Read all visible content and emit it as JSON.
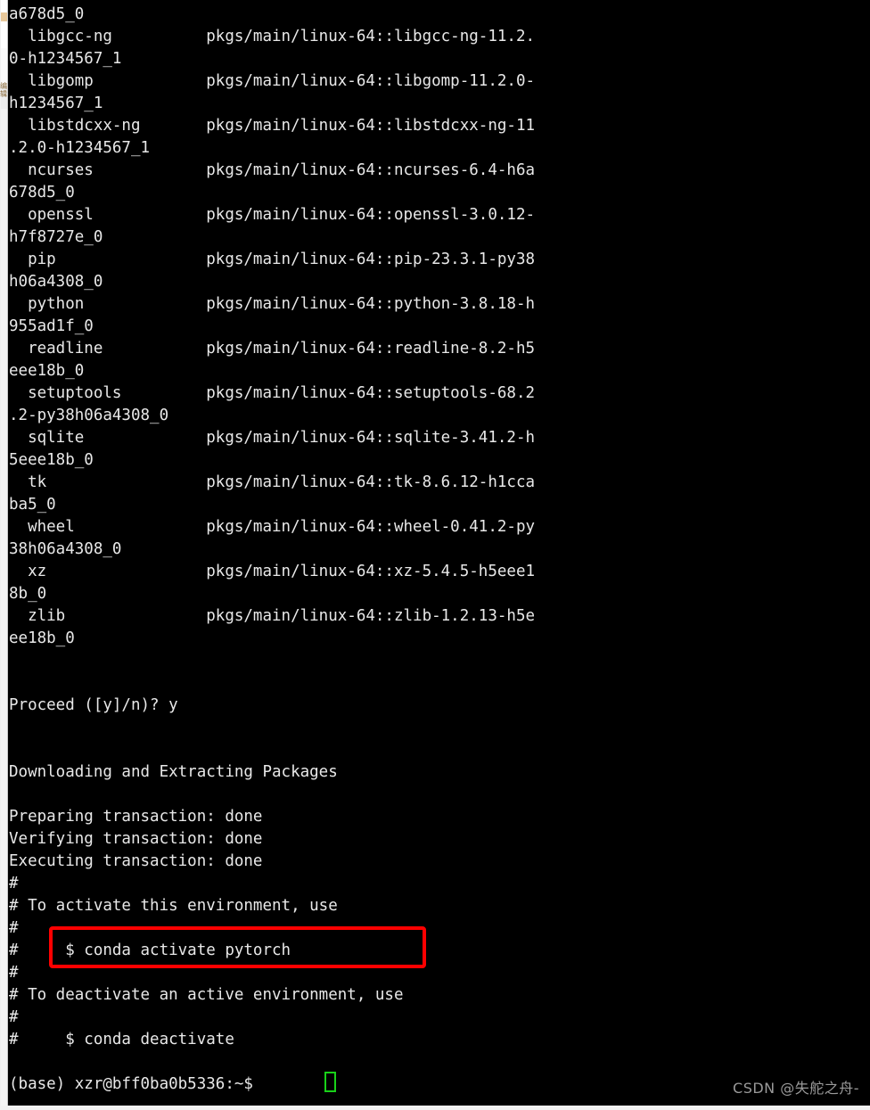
{
  "terminal": {
    "theme": {
      "background": "#000000",
      "foreground": "#e8e8e8",
      "cursor_color": "#19d119",
      "highlight_color": "#fe0000",
      "watermark_color": "#9a9a9a"
    },
    "lines": [
      "a678d5_0",
      "  libgcc-ng          pkgs/main/linux-64::libgcc-ng-11.2.",
      "0-h1234567_1",
      "  libgomp            pkgs/main/linux-64::libgomp-11.2.0-",
      "h1234567_1",
      "  libstdcxx-ng       pkgs/main/linux-64::libstdcxx-ng-11",
      ".2.0-h1234567_1",
      "  ncurses            pkgs/main/linux-64::ncurses-6.4-h6a",
      "678d5_0",
      "  openssl            pkgs/main/linux-64::openssl-3.0.12-",
      "h7f8727e_0",
      "  pip                pkgs/main/linux-64::pip-23.3.1-py38",
      "h06a4308_0",
      "  python             pkgs/main/linux-64::python-3.8.18-h",
      "955ad1f_0",
      "  readline           pkgs/main/linux-64::readline-8.2-h5",
      "eee18b_0",
      "  setuptools         pkgs/main/linux-64::setuptools-68.2",
      ".2-py38h06a4308_0",
      "  sqlite             pkgs/main/linux-64::sqlite-3.41.2-h",
      "5eee18b_0",
      "  tk                 pkgs/main/linux-64::tk-8.6.12-h1cca",
      "ba5_0",
      "  wheel              pkgs/main/linux-64::wheel-0.41.2-py",
      "38h06a4308_0",
      "  xz                 pkgs/main/linux-64::xz-5.4.5-h5eee1",
      "8b_0",
      "  zlib               pkgs/main/linux-64::zlib-1.2.13-h5e",
      "ee18b_0",
      "",
      "",
      "Proceed ([y]/n)? y",
      "",
      "",
      "Downloading and Extracting Packages",
      "",
      "Preparing transaction: done",
      "Verifying transaction: done",
      "Executing transaction: done",
      "#",
      "# To activate this environment, use",
      "#",
      "#     $ conda activate pytorch",
      "#",
      "# To deactivate an active environment, use",
      "#",
      "#     $ conda deactivate",
      "",
      "(base) xzr@bff0ba0b5336:~$ "
    ],
    "packages": [
      {
        "name": "libgcc-ng",
        "spec": "pkgs/main/linux-64::libgcc-ng-11.2.0-h1234567_1"
      },
      {
        "name": "libgomp",
        "spec": "pkgs/main/linux-64::libgomp-11.2.0-h1234567_1"
      },
      {
        "name": "libstdcxx-ng",
        "spec": "pkgs/main/linux-64::libstdcxx-ng-11.2.0-h1234567_1"
      },
      {
        "name": "ncurses",
        "spec": "pkgs/main/linux-64::ncurses-6.4-h6a678d5_0"
      },
      {
        "name": "openssl",
        "spec": "pkgs/main/linux-64::openssl-3.0.12-h7f8727e_0"
      },
      {
        "name": "pip",
        "spec": "pkgs/main/linux-64::pip-23.3.1-py38h06a4308_0"
      },
      {
        "name": "python",
        "spec": "pkgs/main/linux-64::python-3.8.18-h955ad1f_0"
      },
      {
        "name": "readline",
        "spec": "pkgs/main/linux-64::readline-8.2-h5eee18b_0"
      },
      {
        "name": "setuptools",
        "spec": "pkgs/main/linux-64::setuptools-68.2.2-py38h06a4308_0"
      },
      {
        "name": "sqlite",
        "spec": "pkgs/main/linux-64::sqlite-3.41.2-h5eee18b_0"
      },
      {
        "name": "tk",
        "spec": "pkgs/main/linux-64::tk-8.6.12-h1ccaba5_0"
      },
      {
        "name": "wheel",
        "spec": "pkgs/main/linux-64::wheel-0.41.2-py38h06a4308_0"
      },
      {
        "name": "xz",
        "spec": "pkgs/main/linux-64::xz-5.4.5-h5eee18b_0"
      },
      {
        "name": "zlib",
        "spec": "pkgs/main/linux-64::zlib-1.2.13-h5eee18b_0"
      }
    ],
    "prompt_question": "Proceed ([y]/n)? y",
    "status_lines": [
      "Downloading and Extracting Packages",
      "Preparing transaction: done",
      "Verifying transaction: done",
      "Executing transaction: done"
    ],
    "highlighted_command": "$ conda activate pytorch",
    "deactivate_command": "$ conda deactivate",
    "shell_prompt": "(base) xzr@bff0ba0b5336:~$ ",
    "environment_name": "pytorch"
  },
  "chrome": {
    "side_label": "编辑"
  },
  "watermark": {
    "text": "CSDN @失舵之舟-"
  }
}
